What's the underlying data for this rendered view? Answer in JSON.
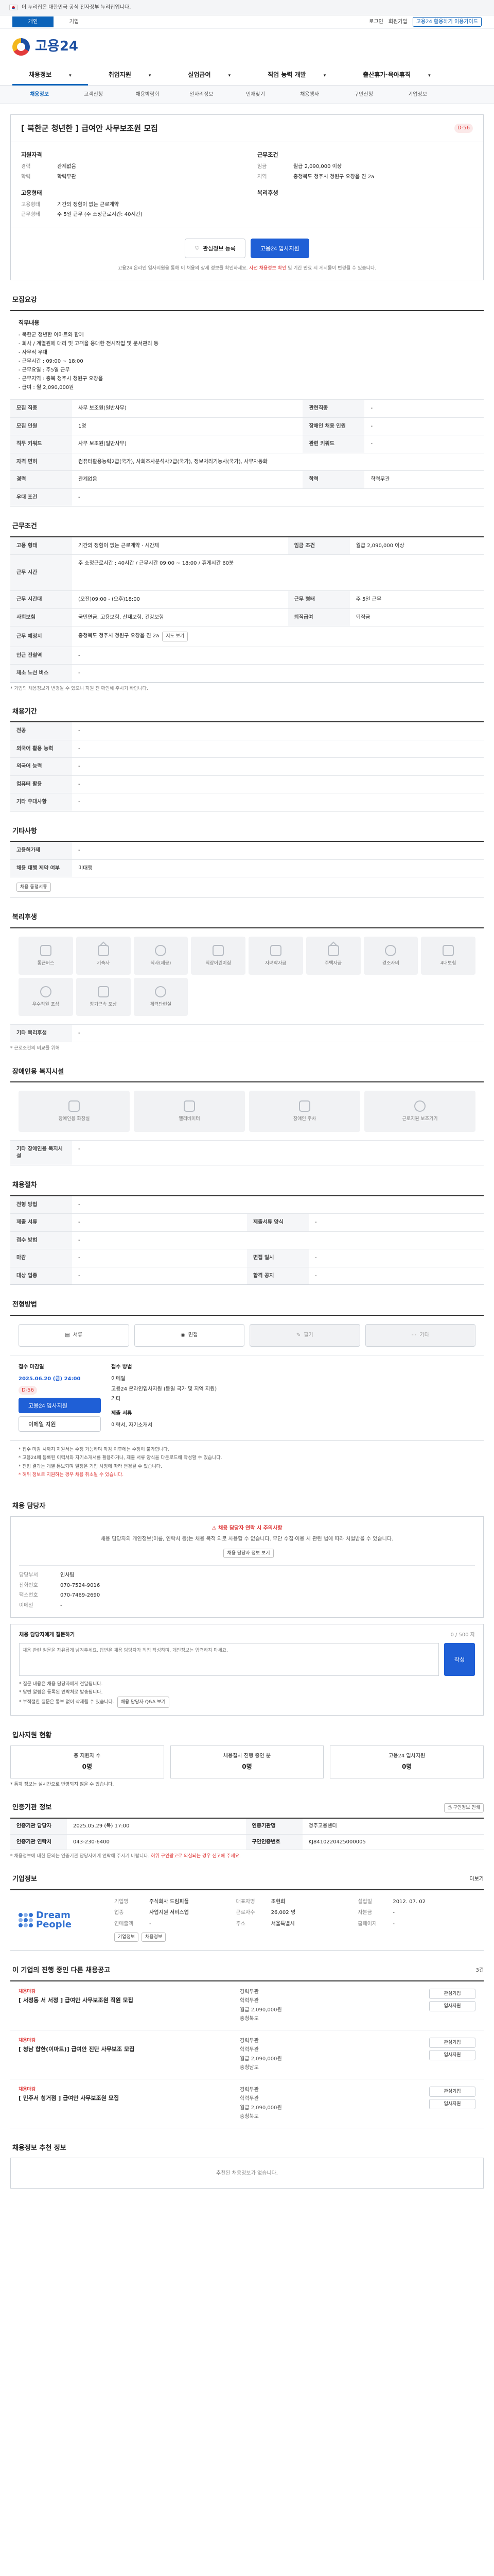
{
  "gov_bar": {
    "text": "이 누리집은 대한민국 공식 전자정부 누리집입니다."
  },
  "top_tabs": [
    {
      "label": "개인",
      "active": true
    },
    {
      "label": "기업",
      "active": false
    }
  ],
  "util_links": {
    "login": "로그인",
    "signup": "회원가입",
    "cta": "고용24 활용하기 이용가이드"
  },
  "logo": {
    "text": "고용24"
  },
  "gnb": [
    "채용정보",
    "취업지원",
    "실업급여",
    "직업 능력 개발",
    "출산휴가·육아휴직"
  ],
  "subnav": [
    "채용정보",
    "고객신청",
    "채용박람회",
    "일자리정보",
    "인재찾기",
    "채용행사",
    "구인신청",
    "기업정보"
  ],
  "title": {
    "heading": "[ 북한군 청년한 ] 급여안 사무보조원 모집",
    "dday": "D-56",
    "left_title": "지원자격",
    "left": [
      {
        "k": "경력",
        "v": "관계없음"
      },
      {
        "k": "학력",
        "v": "학력무관"
      }
    ],
    "right_title": "근무조건",
    "right": [
      {
        "k": "임금",
        "v": "월급 2,090,000 이상"
      },
      {
        "k": "지역",
        "v": "충청북도 청주시 청원구 오창읍 진 2a"
      }
    ],
    "left2_title": "고용형태",
    "left2": [
      {
        "k": "고용형태",
        "v": "기간의 정함이 없는 근로계약"
      },
      {
        "k": "근무형태",
        "v": "주 5일 근무 (주 소정근로시간: 40시간)"
      }
    ],
    "right2_title": "복리후생",
    "right2": [
      {
        "k": "",
        "v": ""
      }
    ],
    "btn_save": "관심정보 등록",
    "btn_apply": "고용24 입사지원",
    "notice": "고용24 온라인 입사지원을 통해 이 채용의 상세 정보를 확인하세요.",
    "notice_em": "사전 채용정보 확인",
    "notice_tail": " 및 기간 만료 시 게시물이 변경될 수 있습니다."
  },
  "sec_recruit": {
    "heading": "모집요강",
    "desc_title": "직무내용",
    "desc_lines": [
      "- 북한군 청년한 이마트와 함께",
      "- 회사 / 계열원에 대리 및 고객을 응대한 전시작업 및 문서관리 등",
      "- 사무직 우대",
      "- 근무시간 : 09:00 ~ 18:00",
      "- 근무요일 : 주5일 근무",
      "- 근무지역 : 충북 청주시 청원구 오창읍",
      "- 급여 : 월 2,090,000원"
    ],
    "rows": [
      {
        "k": "모집 직종",
        "v": "사무 보조원(일반사무)",
        "k2": "관련직종",
        "v2": "-"
      },
      {
        "k": "모집 인원",
        "v": "1명",
        "k2": "장애인 채용 인원",
        "v2": "-"
      },
      {
        "k": "직무 키워드",
        "v": "사무 보조원(일반사무)",
        "k2": "관련 키워드",
        "v2": "-"
      },
      {
        "k": "자격 면허",
        "v": "컴퓨터활용능력2급(국가), 사회조사분석사2급(국가), 정보처리기능사(국가), 사무자동화",
        "k2": "",
        "v2": ""
      },
      {
        "k": "경력",
        "v": "관계없음",
        "k2": "학력",
        "v2": "학력무관"
      },
      {
        "k": "우대 조건",
        "v": "-",
        "k2": "",
        "v2": ""
      }
    ]
  },
  "sec_work": {
    "heading": "근무조건",
    "rows": [
      {
        "k": "고용 형태",
        "v": "기간의 정함이 없는 근로계약 · 시간제",
        "k2": "임금 조건",
        "v2": "월급 2,090,000 이상"
      },
      {
        "k": "근무 시간",
        "v": "주 소정근로시간 : 40시간 / 근무시간 09:00 ~ 18:00 / 휴게시간 60분",
        "k2": "",
        "v2": ""
      },
      {
        "k": "근무 시간대",
        "v": "(오전)09:00 - (오후)18:00",
        "k2": "근무 형태",
        "v2": "주 5일 근무"
      },
      {
        "k": "사회보험",
        "v": "국민연금, 고용보험, 산재보험, 건강보험",
        "k2": "퇴직급여",
        "v2": "퇴직금"
      },
      {
        "k": "근무 예정지",
        "v": "충청북도 청주시 청원구 오창읍 진 2a",
        "k2": "",
        "v2": ""
      },
      {
        "k": "인근 전철역",
        "v": "-",
        "k2": "",
        "v2": ""
      },
      {
        "k": "채소 노선 버스",
        "v": "-",
        "k2": "",
        "v2": ""
      }
    ],
    "map_btn": "지도 보기",
    "note": "* 기업의 채용정보가 변경될 수 있으니 지원 전 확인해 주시기 바랍니다."
  },
  "sec_period": {
    "heading": "채용기간",
    "rows": [
      {
        "k": "전공",
        "v": "-"
      },
      {
        "k": "외국어 활용 능력",
        "v": "-"
      },
      {
        "k": "외국어 능력",
        "v": "-"
      },
      {
        "k": "컴퓨터 활용",
        "v": "-"
      },
      {
        "k": "기타 우대사항",
        "v": "-"
      }
    ]
  },
  "sec_other": {
    "heading": "기타사항",
    "rows": [
      {
        "k": "고용허가제",
        "v": "-"
      },
      {
        "k": "채용 대행 제약 여부",
        "v": "미대행"
      }
    ],
    "extra_btn": "채용 동행서류"
  },
  "sec_welfare": {
    "heading": "복리후생",
    "items": [
      "통근버스",
      "기숙사",
      "식사(제공)",
      "직장어린이집",
      "자녀학자금",
      "주택자금",
      "경조사비",
      "4대보험",
      "우수직원 포상",
      "장기근속 포상",
      "체력단련실"
    ],
    "etc_label": "기타 복리후생",
    "etc_value": "-",
    "foot": "* 근로조건의 비교를 위해"
  },
  "sec_disab": {
    "heading": "장애인용 복지시설",
    "items": [
      "장애인용 화장실",
      "엘리베이터",
      "장애인 주차",
      "근로지원 보조기기"
    ],
    "etc_label": "기타 장애인용 복지시설",
    "etc_value": "-"
  },
  "sec_method": {
    "heading": "채용절차",
    "rows": [
      {
        "k": "전형 방법",
        "v": "-"
      },
      {
        "k": "제출 서류",
        "v": "-",
        "k2": "제출서류 양식",
        "v2": "-"
      },
      {
        "k": "접수 방법",
        "v": "-"
      },
      {
        "k": "마감",
        "v": "-",
        "k2": "면접 일시",
        "v2": "-"
      },
      {
        "k": "대상 업종",
        "v": "-",
        "k2": "합격 공지",
        "v2": "-"
      }
    ]
  },
  "sec_apply": {
    "heading": "전형방법",
    "methods": [
      {
        "label": "서류",
        "disabled": false
      },
      {
        "label": "면접",
        "disabled": false
      },
      {
        "label": "필기",
        "disabled": true
      },
      {
        "label": "기타",
        "disabled": true
      }
    ],
    "receipt_label": "접수 마감일",
    "receipt_date": "2025.06.20 (금) 24:00",
    "dday": "D-56",
    "apply_btn": "고용24 입사지원",
    "email_btn": "이메일 지원",
    "method_label": "접수 방법",
    "method_list": [
      "이메일",
      "고용24 온라인입사지원 (동일 국가 및 지역 지원)",
      "기타"
    ],
    "doc_label": "제출 서류",
    "doc_value": "이력서, 자기소개서",
    "bullets": [
      "* 접수 마감 시까지 지원서는 수정 가능하며 마감 이후에는 수정이 불가합니다.",
      "* 고용24에 등록된 이력서와 자기소개서를 활용하거나, 제출 서류 양식을 다운로드해 작성할 수 있습니다.",
      "* 전형 결과는 개별 통보되며 일정은 기업 사정에 따라 변경될 수 있습니다."
    ],
    "red_note": "* 허위 정보로 지원하는 경우 채용 취소될 수 있습니다."
  },
  "sec_contact": {
    "heading": "채용 담당자",
    "warn_head": "채용 담당자 연락 시 주의사항",
    "warn_text": "채용 담당자의 개인정보(이름, 연락처 등)는 채용 목적 외로 사용할 수 없습니다. 무단 수집·이용 시 관련 법에 따라 처벌받을 수 있습니다.",
    "warn_btn": "채용 담당자 정보 보기",
    "rows": [
      {
        "k": "담당부서",
        "v": "인사팀"
      },
      {
        "k": "전화번호",
        "v": "070-7524-9016"
      },
      {
        "k": "팩스번호",
        "v": "070-7469-2690"
      },
      {
        "k": "이메일",
        "v": "-"
      }
    ],
    "inq_title": "채용 담당자에게 질문하기",
    "inq_count": "0 / 500 자",
    "inq_placeholder": "채용 관련 질문을 자유롭게 남겨주세요. 답변은 채용 담당자가 직접 작성하며, 개인정보는 입력하지 마세요.",
    "inq_btn": "작성",
    "inq_notes": [
      "* 질문 내용은 채용 담당자에게 전달됩니다.",
      "* 답변 알림은 등록된 연락처로 발송됩니다.",
      "* 부적절한 질문은 통보 없이 삭제될 수 있습니다."
    ],
    "inq_link": "채용 담당자 Q&A 보기"
  },
  "sec_status": {
    "heading": "입사지원 현황",
    "cards": [
      {
        "label": "총 지원자 수",
        "value": "0명"
      },
      {
        "label": "채용절차 진행 중인 분",
        "value": "0명"
      },
      {
        "label": "고용24 입사지원",
        "value": "0명"
      }
    ],
    "note": "* 통계 정보는 실시간으로 반영되지 않을 수 있습니다."
  },
  "sec_reg": {
    "heading": "인증기관 정보",
    "btn": "구인정보 인쇄",
    "rows": [
      {
        "k": "인증기관 담당자",
        "v": "2025.05.29 (목) 17:00",
        "k2": "인증기관명",
        "v2": "청주고용센터"
      },
      {
        "k": "인증기관 연락처",
        "v": "043-230-6400",
        "k2": "구인인증번호",
        "v2": "KJ8410220425000005"
      }
    ],
    "note": "* 채용정보에 대한 문의는 인증기관 담당자에게 연락해 주시기 바랍니다.",
    "note_red": "허위 구인광고로 의심되는 경우 신고해 주세요."
  },
  "sec_company": {
    "heading": "기업정보",
    "more": "더보기",
    "logo_name": "Dream People",
    "rows": [
      {
        "k": "기업명",
        "v": "주식회사 드림피플"
      },
      {
        "k": "대표자명",
        "v": "조현희"
      },
      {
        "k": "설립일",
        "v": "2012. 07. 02"
      },
      {
        "k": "업종",
        "v": "사업지원 서비스업"
      },
      {
        "k": "근로자수",
        "v": "26,002 명"
      },
      {
        "k": "자본금",
        "v": "-"
      },
      {
        "k": "연매출액",
        "v": "-"
      },
      {
        "k": "주소",
        "v": "서울특별시"
      },
      {
        "k": "홈페이지",
        "v": "-"
      }
    ],
    "btns": [
      "기업정보",
      "채용정보"
    ]
  },
  "sec_jobs": {
    "heading": "이 기업의 진행 중인 다른 채용공고",
    "count_text": "3건",
    "items": [
      {
        "tag": "채용마감",
        "title": "[ 서정동 서 서정 ] 급여안 사무보조원 직원 모집",
        "career": "경력무관",
        "edu": "학력무관",
        "pay": "월급 2,090,000원",
        "area": "충청북도",
        "actions": [
          "관심기업",
          "입사지원"
        ]
      },
      {
        "tag": "채용마감",
        "title": "[ 청남 합한(이마트)] 급여안 진단 사무보조 모집",
        "career": "경력무관",
        "edu": "학력무관",
        "pay": "월급 2,090,000원",
        "area": "충청남도",
        "actions": [
          "관심기업",
          "입사지원"
        ]
      },
      {
        "tag": "채용마감",
        "title": "[ 민주서 청거점 ] 급여안 사무보조원 모집",
        "career": "경력무관",
        "edu": "학력무관",
        "pay": "월급 2,090,000원",
        "area": "충청북도",
        "actions": [
          "관심기업",
          "입사지원"
        ]
      }
    ]
  },
  "sec_recommend": {
    "heading": "채용정보 추천 정보",
    "empty": "추천된 채용정보가 없습니다."
  }
}
